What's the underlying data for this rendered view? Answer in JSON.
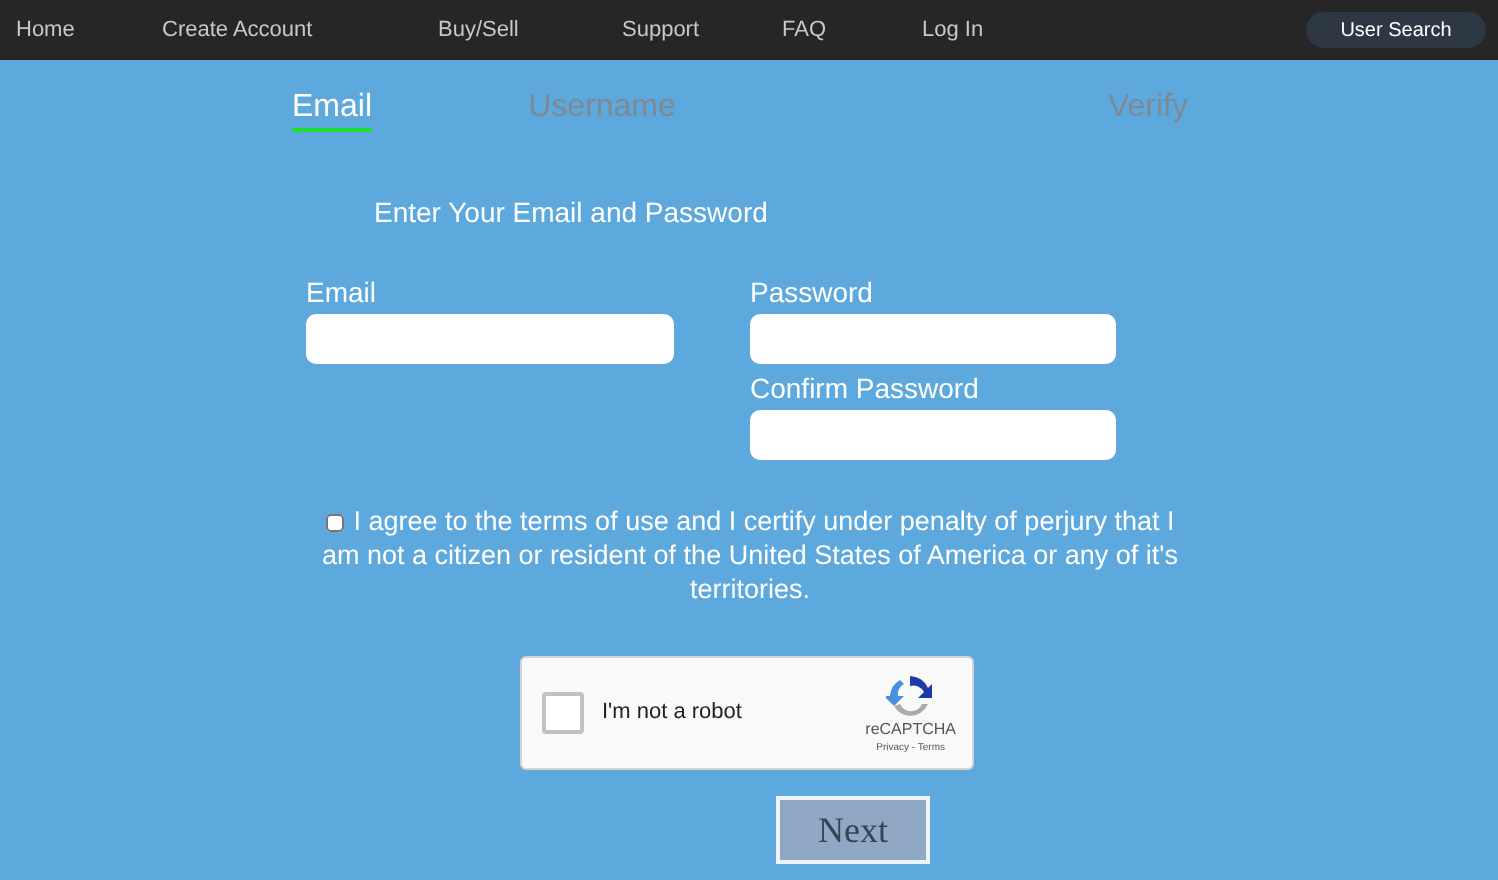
{
  "nav": {
    "links": [
      "Home",
      "Create Account",
      "Buy/Sell",
      "Support",
      "FAQ",
      "Log In"
    ],
    "search_button": "User Search"
  },
  "steps": [
    {
      "label": "Email",
      "selected": true
    },
    {
      "label": "Username",
      "selected": false
    },
    {
      "label": "Verify",
      "selected": false
    }
  ],
  "heading": "Enter Your Email and Password",
  "fields": {
    "email": {
      "label": "Email"
    },
    "password": {
      "label": "Password"
    },
    "confirm": {
      "label": "Confirm Password"
    }
  },
  "agree": {
    "checked": false,
    "text": "I agree to the terms of use and I certify under penalty of perjury that I am not a citizen or resident of the United States of America or any of it's territories."
  },
  "captcha": {
    "checked": false,
    "label": "I'm not a robot",
    "brand": "reCAPTCHA",
    "links": "Privacy - Terms"
  },
  "next_button": "Next"
}
